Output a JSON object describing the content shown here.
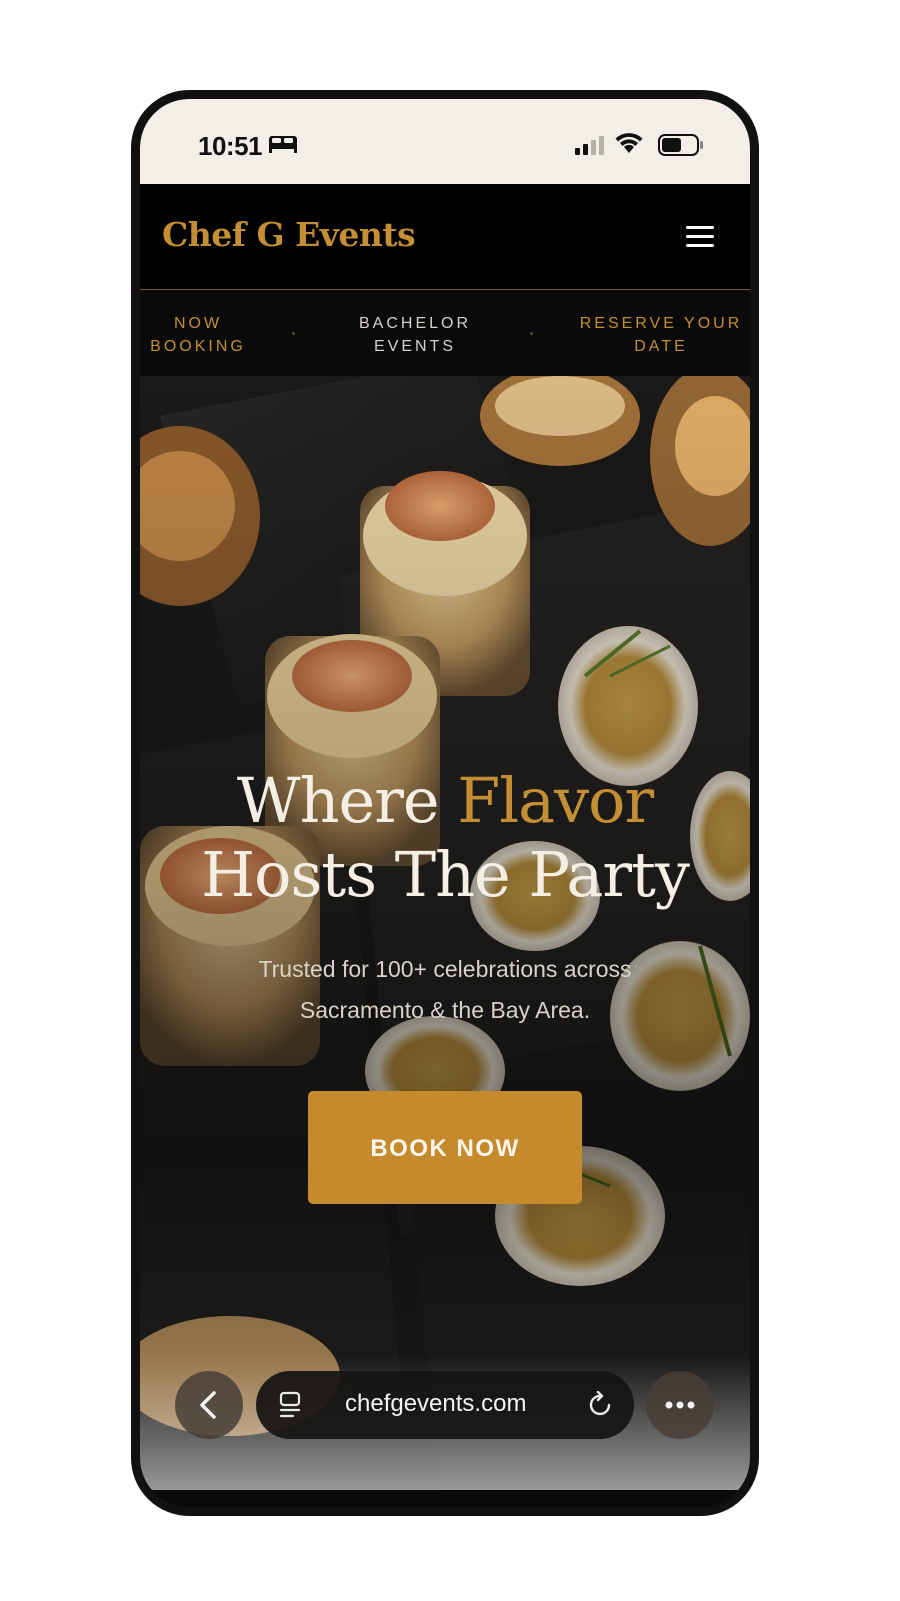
{
  "status_bar": {
    "time": "10:51"
  },
  "header": {
    "brand": "Chef G Events"
  },
  "ticker": {
    "items": [
      {
        "line1": "NOW",
        "line2": "BOOKING"
      },
      {
        "line1": "BACHELOR",
        "line2": "EVENTS"
      },
      {
        "line1": "RESERVE YOUR",
        "line2": "DATE"
      }
    ]
  },
  "hero": {
    "title_part1": "Where ",
    "title_accent": "Flavor",
    "title_line2": "Hosts The Party",
    "subtitle_line1": "Trusted for 100+ celebrations across",
    "subtitle_line2": "Sacramento & the Bay Area.",
    "cta": "BOOK NOW"
  },
  "browser": {
    "url": "chefgevents.com"
  },
  "colors": {
    "accent": "#c48f34",
    "button": "#c48a2c",
    "header_bg": "#000000",
    "status_bg": "#f3efe8"
  },
  "icons": {
    "status": [
      "bed-icon",
      "signal-icon",
      "wifi-icon",
      "battery-icon"
    ],
    "header": [
      "hamburger-menu-icon"
    ],
    "browser": [
      "back-arrow-icon",
      "tabs-icon",
      "reload-icon",
      "more-dots-icon"
    ]
  }
}
